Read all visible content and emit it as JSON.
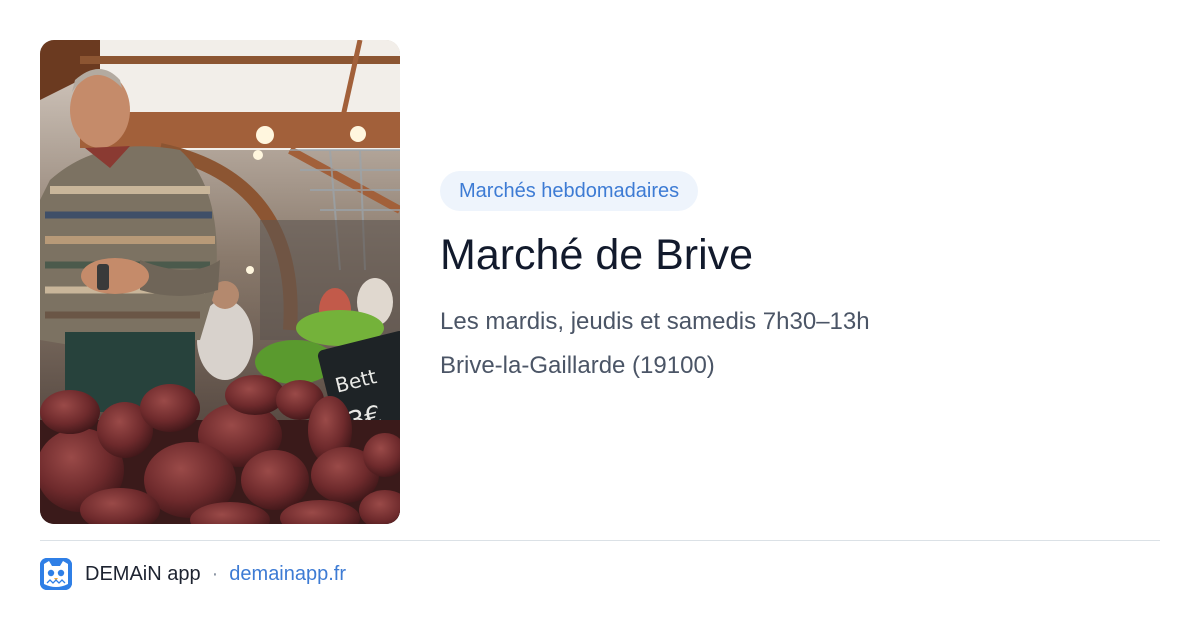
{
  "photo": {
    "subject": "market-vendor-beets-photo",
    "sign_text_line1": "Bett",
    "sign_text_line2": "3€"
  },
  "badge": {
    "label": "Marchés hebdomadaires"
  },
  "title": "Marché de Brive",
  "schedule": "Les mardis, jeudis et samedis 7h30–13h",
  "location": "Brive-la-Gaillarde (19100)",
  "footer": {
    "app_icon": "owl-app-icon",
    "app_name": "DEMAiN app",
    "separator": "·",
    "link": "demainapp.fr"
  },
  "colors": {
    "accent": "#3d7bd4",
    "badge_bg": "#eef4fc",
    "title": "#121a2c",
    "body_text": "#4b5566",
    "divider": "#dbe1e6",
    "app_icon_bg": "#2f7fe6"
  }
}
